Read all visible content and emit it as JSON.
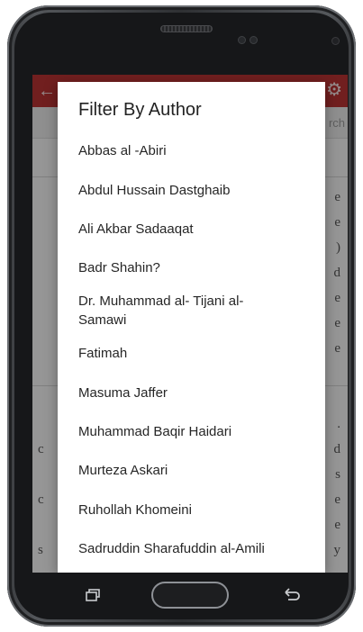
{
  "search": {
    "hint": "rch"
  },
  "dialog": {
    "title": "Filter By Author",
    "authors": [
      "Abbas al -Abiri",
      "Abdul Hussain Dastghaib",
      "Ali Akbar Sadaaqat",
      "Badr Shahin?",
      "Dr. Muhammad al- Tijani al-Samawi",
      "Fatimah",
      "Masuma Jaffer",
      "Muhammad Baqir Haidari",
      "Murteza Askari",
      "Ruhollah Khomeini",
      "Sadruddin Sharafuddin al-Amili"
    ]
  },
  "colors": {
    "appbar": "#b73333",
    "dialog_bg": "#ffffff"
  },
  "icons": {
    "appbar": [
      "back-arrow-icon",
      "gear-icon"
    ],
    "navbar": [
      "recent-apps-icon",
      "home-button",
      "back-icon"
    ]
  }
}
